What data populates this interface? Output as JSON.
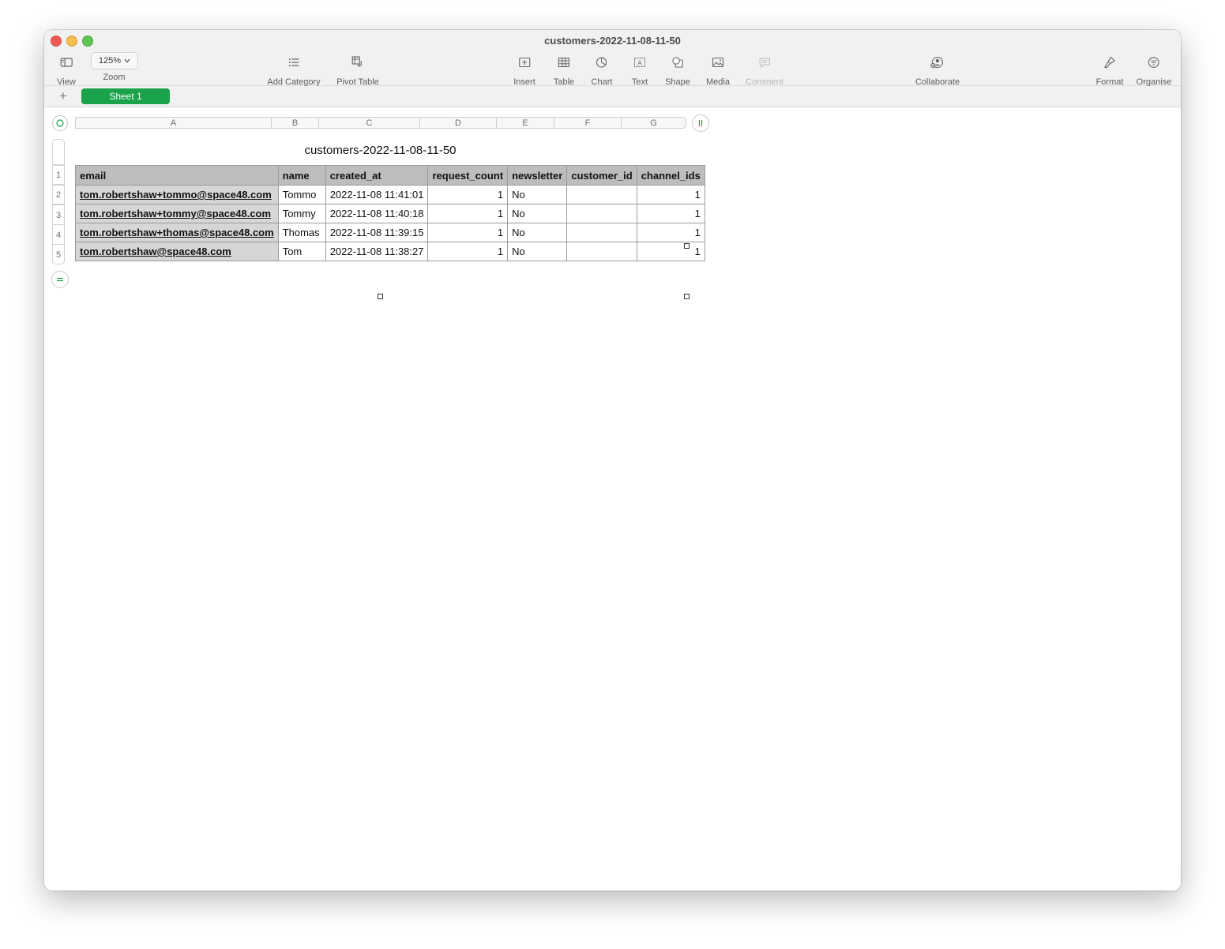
{
  "window": {
    "title": "customers-2022-11-08-11-50"
  },
  "toolbar": {
    "view_label": "View",
    "zoom_value": "125%",
    "zoom_label": "Zoom",
    "add_category_label": "Add Category",
    "pivot_table_label": "Pivot Table",
    "insert_label": "Insert",
    "table_label": "Table",
    "chart_label": "Chart",
    "text_label": "Text",
    "shape_label": "Shape",
    "media_label": "Media",
    "comment_label": "Comment",
    "collaborate_label": "Collaborate",
    "format_label": "Format",
    "organise_label": "Organise"
  },
  "sheets": {
    "add_symbol": "+",
    "active": "Sheet 1"
  },
  "table": {
    "title": "customers-2022-11-08-11-50",
    "column_letters": [
      "A",
      "B",
      "C",
      "D",
      "E",
      "F",
      "G"
    ],
    "row_numbers": [
      "1",
      "2",
      "3",
      "4",
      "5"
    ],
    "headers": [
      "email",
      "name",
      "created_at",
      "request_count",
      "newsletter",
      "customer_id",
      "channel_ids"
    ],
    "rows": [
      [
        "tom.robertshaw+tommo@space48.com",
        "Tommo",
        "2022-11-08 11:41:01",
        "1",
        "No",
        "",
        "1"
      ],
      [
        "tom.robertshaw+tommy@space48.com",
        "Tommy",
        "2022-11-08 11:40:18",
        "1",
        "No",
        "",
        "1"
      ],
      [
        "tom.robertshaw+thomas@space48.com",
        "Thomas",
        "2022-11-08 11:39:15",
        "1",
        "No",
        "",
        "1"
      ],
      [
        "tom.robertshaw@space48.com",
        "Tom",
        "2022-11-08 11:38:27",
        "1",
        "No",
        "",
        "1"
      ]
    ]
  }
}
